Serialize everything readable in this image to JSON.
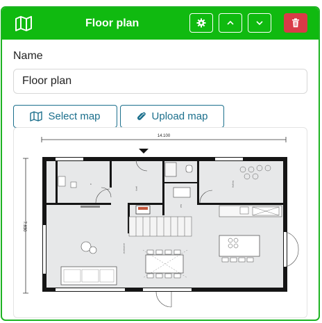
{
  "header": {
    "title": "Floor plan",
    "icons": {
      "map": "map-icon",
      "settings": "gear-icon",
      "up": "chevron-up-icon",
      "down": "chevron-down-icon",
      "delete": "trash-icon"
    },
    "colors": {
      "bar": "#10ba10",
      "border": "#1db322",
      "delete": "#d93b47"
    }
  },
  "form": {
    "name_label": "Name",
    "name_value": "Floor plan"
  },
  "actions": {
    "select_map_label": "Select map",
    "upload_map_label": "Upload map",
    "select_map_icon": "map-icon",
    "upload_map_icon": "paperclip-icon",
    "color": "#1b6f8c"
  },
  "floorplan": {
    "width_dimension": "14.100",
    "height_dimension": "7.830"
  }
}
